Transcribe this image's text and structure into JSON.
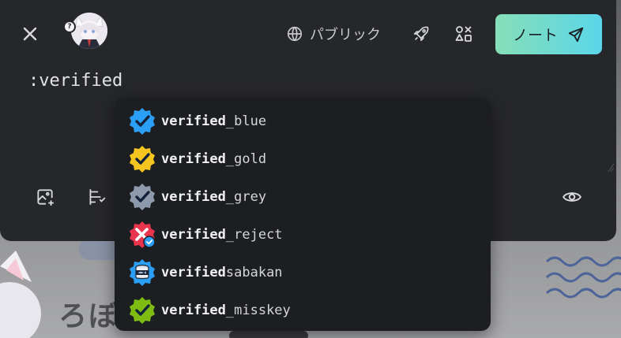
{
  "background": {
    "text": "ろぼ"
  },
  "header": {
    "avatar_badge": "?",
    "visibility_label": "パブリック",
    "post_button_label": "ノート"
  },
  "composer": {
    "text_value": ":verified"
  },
  "autocomplete": {
    "query": "verified",
    "items": [
      {
        "match": "verified",
        "rest": "_blue",
        "icon": "verified-blue-icon",
        "color": "#2a9ff5"
      },
      {
        "match": "verified",
        "rest": "_gold",
        "icon": "verified-gold-icon",
        "color": "#f5c51f"
      },
      {
        "match": "verified",
        "rest": "_grey",
        "icon": "verified-grey-icon",
        "color": "#8c9aab"
      },
      {
        "match": "verified",
        "rest": "_reject",
        "icon": "verified-reject-icon",
        "color": "#e8354d"
      },
      {
        "match": "verified",
        "rest": "sabakan",
        "icon": "verified-sabakan-icon",
        "color": "#2a9ff5"
      },
      {
        "match": "verified",
        "rest": "_misskey",
        "icon": "verified-misskey-icon",
        "color": "#7ebc12"
      }
    ]
  },
  "colors": {
    "accent_gradient_start": "#86dfb7",
    "accent_gradient_end": "#5ad6e9",
    "panel": "#26272b",
    "popup": "#1d1e22"
  }
}
